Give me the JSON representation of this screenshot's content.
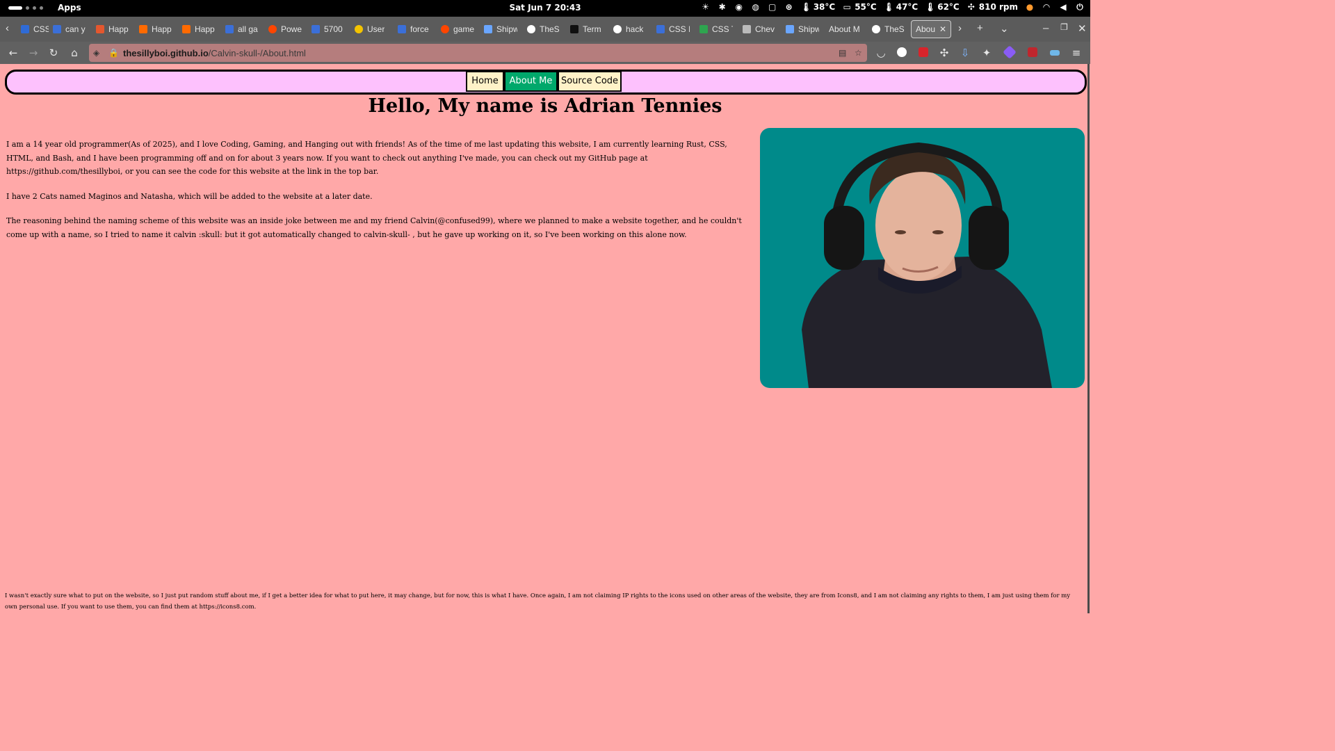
{
  "topbar": {
    "apps_label": "Apps",
    "clock": "Sat Jun 7  20:43",
    "stats": [
      "38°C",
      "55°C",
      "47°C",
      "62°C",
      "810 rpm"
    ]
  },
  "tabs": [
    {
      "label": "CSS E",
      "icon": "css-icon",
      "color": "#2f6bd6"
    },
    {
      "label": "can y",
      "icon": "css-icon",
      "color": "#3b6fd8"
    },
    {
      "label": "Happ",
      "icon": "heart-icon",
      "color": "#e4572e"
    },
    {
      "label": "Happ",
      "icon": "heart-icon",
      "color": "#ff6a00"
    },
    {
      "label": "Happ",
      "icon": "heart-icon",
      "color": "#ff6a00"
    },
    {
      "label": "all ga",
      "icon": "css-icon",
      "color": "#3b6fd8"
    },
    {
      "label": "Powe",
      "icon": "reddit-icon",
      "color": "#ff4500"
    },
    {
      "label": "5700",
      "icon": "css-icon",
      "color": "#3b6fd8"
    },
    {
      "label": "User",
      "icon": "clock-icon",
      "color": "#f4c400"
    },
    {
      "label": "force",
      "icon": "css-icon",
      "color": "#3b6fd8"
    },
    {
      "label": "game",
      "icon": "reddit-icon",
      "color": "#ff4500"
    },
    {
      "label": "Shipw",
      "icon": "ship-icon",
      "color": "#6aa6ff"
    },
    {
      "label": "TheS",
      "icon": "github-icon",
      "color": "#ffffff"
    },
    {
      "label": "Term",
      "icon": "terminal-icon",
      "color": "#101010"
    },
    {
      "label": "hack",
      "icon": "github-icon",
      "color": "#ffffff"
    },
    {
      "label": "CSS I",
      "icon": "css-icon",
      "color": "#3b6fd8"
    },
    {
      "label": "CSS T",
      "icon": "css-icon",
      "color": "#2ea44f"
    },
    {
      "label": "Chev",
      "icon": "chevron-icon",
      "color": "#bbbbbb"
    },
    {
      "label": "Shipw",
      "icon": "ship-icon",
      "color": "#6aa6ff"
    },
    {
      "label": "About M",
      "icon": "",
      "color": ""
    },
    {
      "label": "TheS",
      "icon": "github-icon",
      "color": "#ffffff"
    },
    {
      "label": "About",
      "icon": "",
      "color": "",
      "active": true
    }
  ],
  "browser": {
    "url_host": "thesillyboi.github.io",
    "url_path": "/Calvin-skull-/About.html"
  },
  "site": {
    "nav": [
      {
        "label": "Home",
        "bg": "#fff2c8",
        "color": "#000000"
      },
      {
        "label": "About Me",
        "bg": "#00a86b",
        "color": "#ffffff"
      },
      {
        "label": "Source Code",
        "bg": "#fff2c8",
        "color": "#000000"
      }
    ],
    "heading": "Hello, My name is Adrian Tennies",
    "paragraphs": [
      "I am a 14 year old programmer(As of 2025), and I love Coding, Gaming, and Hanging out with friends! As of the time of me last updating this website, I am currently learning Rust, CSS, HTML, and Bash, and I have been programming off and on for about 3 years now. If you want to check out anything I've made, you can check out my GitHub page at https://github.com/thesillyboi, or you can see the code for this website at the link in the top bar.",
      "I have 2 Cats named Maginos and Natasha, which will be added to the website at a later date.",
      "The reasoning behind the naming scheme of this website was an inside joke between me and my friend Calvin(@confused99), where we planned to make a website together, and he couldn't come up with a name, so I tried to name it calvin :skull: but it got automatically changed to calvin-skull- , but he gave up working on it, so I've been working on this alone now."
    ],
    "footer": "I wasn't exactly sure what to put on the website, so I just put random stuff about me, if I get a better idea for what to put here, it may change, but for now, this is what I have. Once again, I am not claiming IP rights to the icons used on other areas of the website, they are from Icons8, and I am not claiming any rights to them, I am just using them for my own personal use. If you want to use them, you can find them at https://icons8.com.",
    "photo_bg": "#008a8a"
  }
}
